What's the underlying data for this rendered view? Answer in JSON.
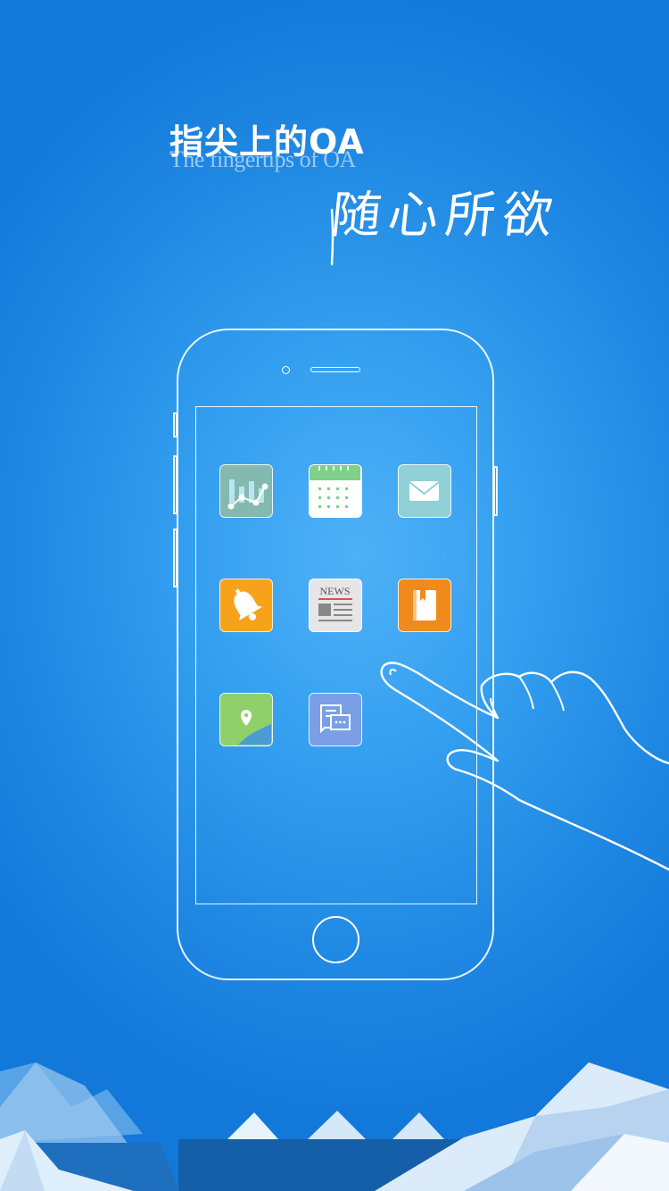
{
  "headline": "指尖上的OA",
  "subline": "The fingertips of OA",
  "slogan": "随心所欲",
  "colors": {
    "background": "#2089e3",
    "chart_app": "#83b9ae",
    "calendar_app": "#ffffff",
    "mail_app": "#8fd1d6",
    "bell_app": "#f7a21b",
    "news_app": "#e6e6e6",
    "book_app": "#f08a1d",
    "map_app": "#8fd06a",
    "chat_app": "#7b9fe6"
  },
  "apps": [
    {
      "name": "chart-app-icon",
      "badge": ""
    },
    {
      "name": "calendar-app-icon",
      "badge": ""
    },
    {
      "name": "mail-app-icon",
      "badge": ""
    },
    {
      "name": "bell-app-icon",
      "badge": ""
    },
    {
      "name": "news-app-icon",
      "badge": "NEWS"
    },
    {
      "name": "book-app-icon",
      "badge": ""
    },
    {
      "name": "map-app-icon",
      "badge": ""
    },
    {
      "name": "chat-app-icon",
      "badge": ""
    }
  ]
}
